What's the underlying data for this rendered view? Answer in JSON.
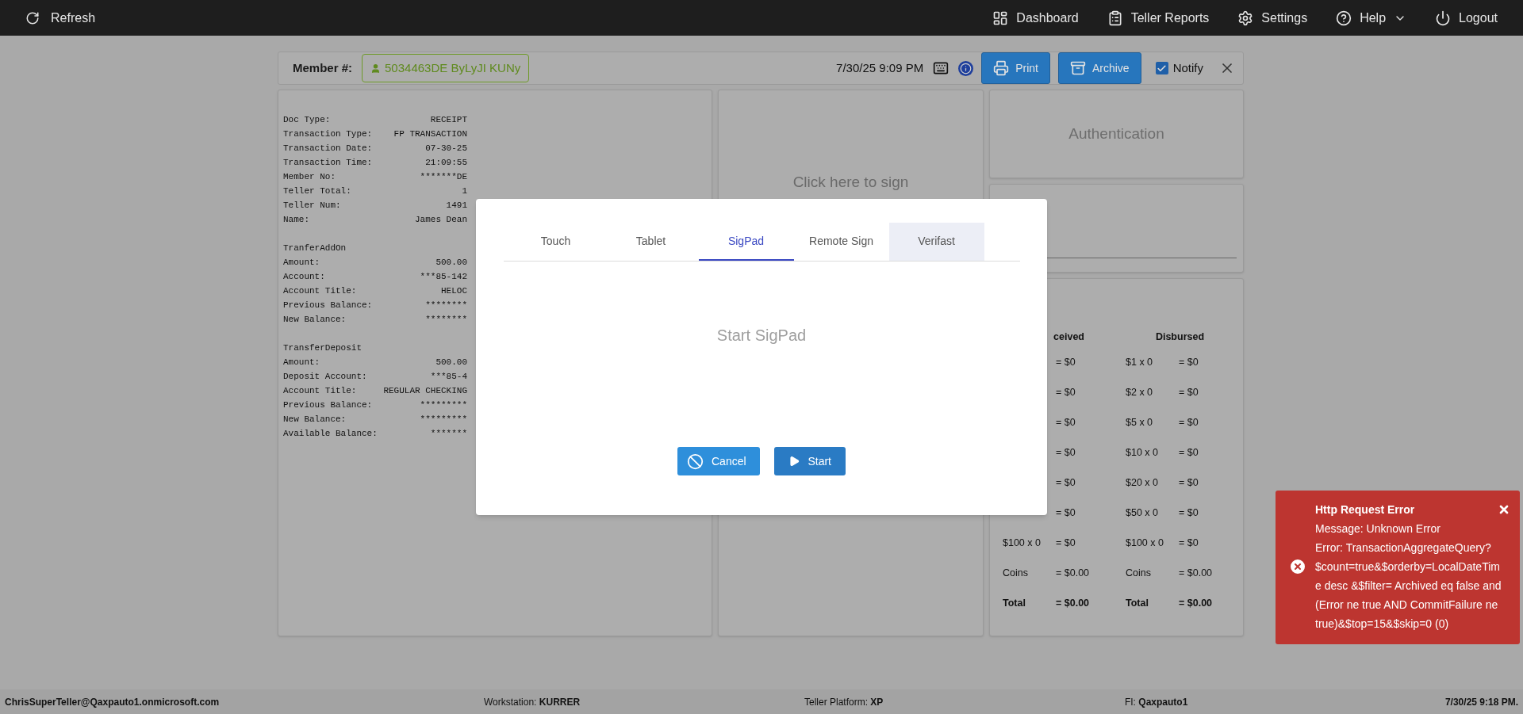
{
  "top_bar": {
    "refresh": "Refresh",
    "menu": [
      {
        "label": "Dashboard",
        "kind": "dashboard"
      },
      {
        "label": "Teller Reports",
        "kind": "reports"
      },
      {
        "label": "Settings",
        "kind": "settings"
      },
      {
        "label": "Help",
        "kind": "help"
      },
      {
        "label": "Logout",
        "kind": "logout"
      }
    ]
  },
  "member_bar": {
    "label": "Member #:",
    "member": "5034463DE ByLyJI KUNy",
    "datetime": "7/30/25 9:09 PM",
    "buttons": [
      {
        "label": "Print",
        "kind": "print"
      },
      {
        "label": "Archive",
        "kind": "archive"
      }
    ],
    "notify": {
      "label": "Notify",
      "checked": true
    }
  },
  "receipt": {
    "sections": [
      {
        "lines": [
          {
            "label": "Doc Type:",
            "value": "RECEIPT"
          },
          {
            "label": "Transaction Type:",
            "value": "FP TRANSACTION"
          },
          {
            "label": "Transaction Date:",
            "value": "07-30-25"
          },
          {
            "label": "Transaction Time:",
            "value": "21:09:55"
          },
          {
            "label": "Member No:",
            "value": "*******DE"
          },
          {
            "label": "Teller Total:",
            "value": "1"
          },
          {
            "label": "Teller Num:",
            "value": "1491"
          },
          {
            "label": "Name:",
            "value": "James Dean"
          }
        ]
      },
      {
        "heading": "TranferAddOn",
        "lines": [
          {
            "label": "Amount:",
            "value": "500.00"
          },
          {
            "label": "Account:",
            "value": "***85-142"
          },
          {
            "label": "Account Title:",
            "value": "HELOC"
          },
          {
            "label": "Previous Balance:",
            "value": "********"
          },
          {
            "label": "New Balance:",
            "value": "********"
          }
        ]
      },
      {
        "heading": "TransferDeposit",
        "lines": [
          {
            "label": "Amount:",
            "value": "500.00"
          },
          {
            "label": "Deposit Account:",
            "value": "***85-4"
          },
          {
            "label": "Account Title:",
            "value": "REGULAR CHECKING"
          },
          {
            "label": "Previous Balance:",
            "value": "*********"
          },
          {
            "label": "New Balance:",
            "value": "*********"
          },
          {
            "label": "Available Balance:",
            "value": "*******"
          }
        ]
      }
    ]
  },
  "signature_panel": {
    "prompt": "Click here to sign"
  },
  "authentication": {
    "title": "Authentication"
  },
  "cash": {
    "headings": [
      "ceived",
      "Disbursed"
    ],
    "rows": [
      {
        "kind": "denomination",
        "received_value": "= $0",
        "disbursed_label": "$1 x 0",
        "disbursed_value": "= $0"
      },
      {
        "kind": "denomination",
        "received_value": "= $0",
        "disbursed_label": "$2 x 0",
        "disbursed_value": "= $0"
      },
      {
        "kind": "denomination",
        "received_value": "= $0",
        "disbursed_label": "$5 x 0",
        "disbursed_value": "= $0"
      },
      {
        "kind": "denomination",
        "received_value": "= $0",
        "disbursed_label": "$10 x 0",
        "disbursed_value": "= $0"
      },
      {
        "kind": "denomination",
        "received_value": "= $0",
        "disbursed_label": "$20 x 0",
        "disbursed_value": "= $0"
      },
      {
        "kind": "denomination",
        "received_value": "= $0",
        "disbursed_label": "$50 x 0",
        "disbursed_value": "= $0"
      },
      {
        "kind": "denomination",
        "received_label": "$100 x 0",
        "received_value": "= $0",
        "disbursed_label": "$100 x 0",
        "disbursed_value": "= $0"
      },
      {
        "kind": "denomination",
        "received_label": "Coins",
        "received_value": "= $0.00",
        "disbursed_label": "Coins",
        "disbursed_value": "= $0.00"
      },
      {
        "kind": "total",
        "received_label": "Total",
        "received_value": "= $0.00",
        "disbursed_label": "Total",
        "disbursed_value": "= $0.00"
      }
    ]
  },
  "dialog": {
    "tabs": [
      {
        "label": "Touch",
        "selected": false,
        "highlighted": false
      },
      {
        "label": "Tablet",
        "selected": false,
        "highlighted": false
      },
      {
        "label": "SigPad",
        "selected": true,
        "highlighted": false
      },
      {
        "label": "Remote Sign",
        "selected": false,
        "highlighted": false
      },
      {
        "label": "Verifast",
        "selected": false,
        "highlighted": true
      }
    ],
    "message": "Start SigPad",
    "buttons": [
      {
        "label": "Cancel",
        "kind": "cancel"
      },
      {
        "label": "Start",
        "kind": "start"
      }
    ]
  },
  "toast": {
    "title": "Http Request Error",
    "lines": [
      "Message: Unknown Error",
      "Error: TransactionAggregateQuery?$count=true&$orderby=LocalDateTime desc &$filter= Archived eq false and (Error ne true AND CommitFailure ne true)&$top=15&$skip=0 (0)"
    ]
  },
  "status_bar": {
    "user": "ChrisSuperTeller@Qaxpauto1.onmicrosoft.com",
    "workstation": "Workstation: **KURRER**",
    "platform": "Teller Platform: **XP**",
    "fi": "FI: **Qaxpauto1**",
    "datetime": "7/30/25 9:18 PM."
  }
}
